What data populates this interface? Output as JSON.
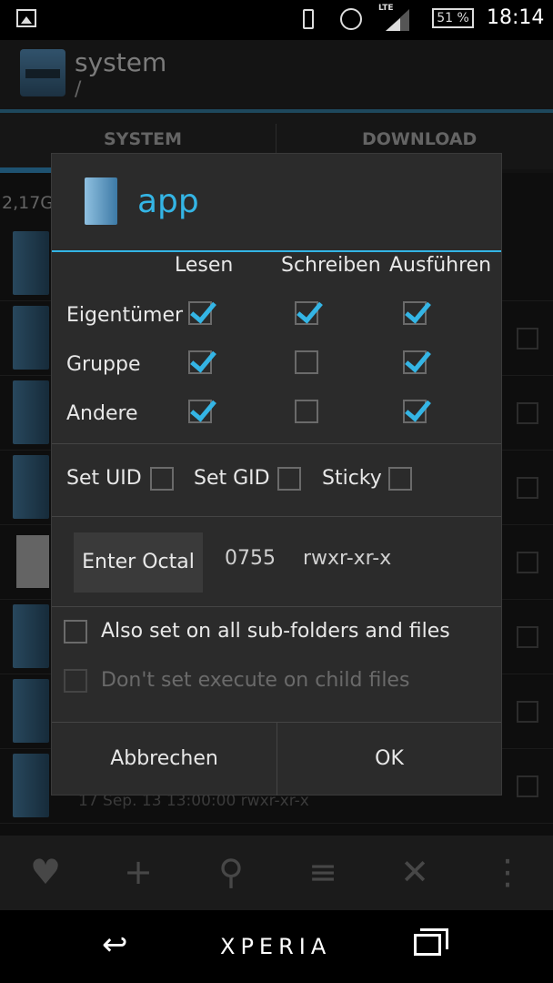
{
  "status_bar": {
    "battery": "51 %",
    "network": "LTE",
    "time": "18:14"
  },
  "app_bar": {
    "title": "system",
    "subtitle": "/"
  },
  "tabs": [
    {
      "label": "SYSTEM"
    },
    {
      "label": "DOWNLOAD"
    }
  ],
  "background": {
    "free_space": "2,17G",
    "partial_meta": "17 Sep. 13 13:00:00   rwxr-xr-x"
  },
  "dialog": {
    "title": "app",
    "columns": [
      "Lesen",
      "Schreiben",
      "Ausführen"
    ],
    "rows": [
      {
        "label": "Eigentümer",
        "read": true,
        "write": true,
        "execute": true
      },
      {
        "label": "Gruppe",
        "read": true,
        "write": false,
        "execute": true
      },
      {
        "label": "Andere",
        "read": true,
        "write": false,
        "execute": true
      }
    ],
    "special": [
      {
        "label": "Set UID",
        "checked": false
      },
      {
        "label": "Set GID",
        "checked": false
      },
      {
        "label": "Sticky",
        "checked": false
      }
    ],
    "octal_button": "Enter Octal",
    "octal_value": "0755",
    "octal_symbolic": "rwxr-xr-x",
    "options": [
      {
        "label": "Also set on all sub-folders and files",
        "enabled": true,
        "checked": false
      },
      {
        "label": "Don't set execute on child files",
        "enabled": false,
        "checked": false
      }
    ],
    "cancel_label": "Abbrechen",
    "ok_label": "OK"
  },
  "nav_bar": {
    "brand": "XPERIA"
  },
  "colors": {
    "accent": "#34b5e5",
    "dialog_bg": "#2b2b2b"
  }
}
